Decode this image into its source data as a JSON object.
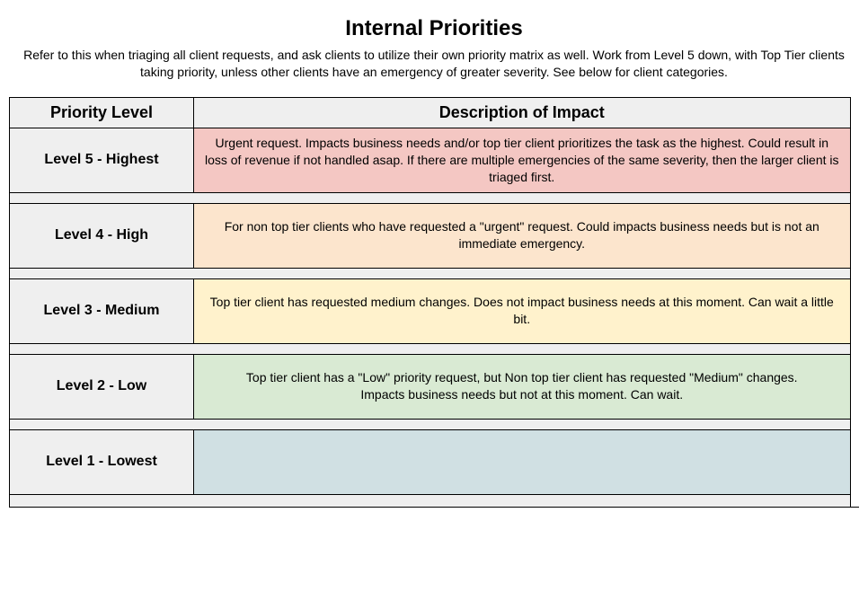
{
  "title": "Internal Priorities",
  "subtitle": "Refer to this when triaging all client requests, and ask clients to utilize their own priority matrix as well. Work from Level 5 down, with Top Tier clients taking priority, unless other clients have an emergency of greater severity. See below for client categories.",
  "headers": {
    "level": "Priority Level",
    "desc": "Description of Impact"
  },
  "rows": [
    {
      "level": "Level 5 - Highest",
      "desc": "Urgent request. Impacts business needs and/or top tier client prioritizes the task as the highest. Could result in loss of revenue if not handled asap. If there are multiple emergencies of the same severity, then the larger client is triaged first.",
      "tintClass": "tint-5"
    },
    {
      "level": "Level 4 - High",
      "desc": "For non top tier clients who have requested a \"urgent\" request. Could impacts business needs but is not an immediate emergency.",
      "tintClass": "tint-4"
    },
    {
      "level": "Level 3 - Medium",
      "desc": "Top tier client has requested medium changes. Does not impact business needs at this moment. Can wait a little bit.",
      "tintClass": "tint-3"
    },
    {
      "level": "Level 2 - Low",
      "desc": "Top tier client has a \"Low\" priority request, but Non top tier client has requested \"Medium\" changes.\nImpacts business needs but not at this moment. Can wait.",
      "tintClass": "tint-2"
    },
    {
      "level": "Level 1 - Lowest",
      "desc": "",
      "tintClass": "tint-1"
    }
  ]
}
